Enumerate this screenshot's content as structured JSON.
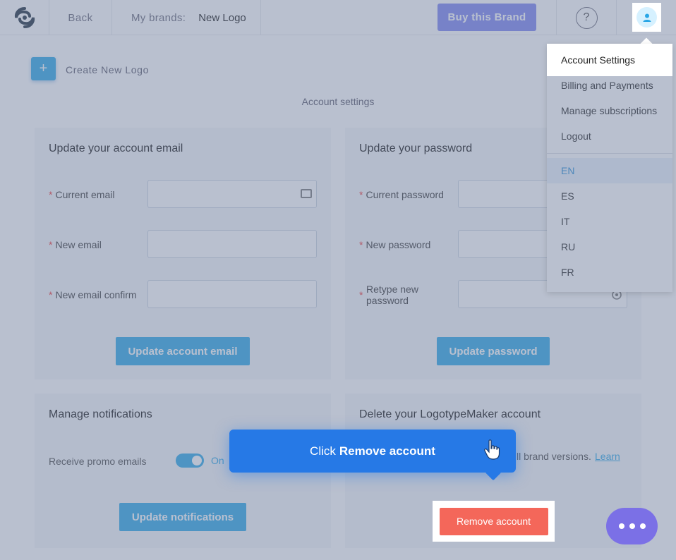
{
  "topbar": {
    "back_label": "Back",
    "brands_label": "My brands:",
    "brand_name": "New Logo",
    "buy_label": "Buy this Brand",
    "help_label": "?"
  },
  "main": {
    "create_label": "Create New Logo",
    "create_icon": "+",
    "section_title": "Account settings"
  },
  "email_card": {
    "title": "Update your account email",
    "fields": [
      "Current email",
      "New email",
      "New email confirm"
    ],
    "button": "Update account email"
  },
  "password_card": {
    "title": "Update your password",
    "fields": [
      "Current password",
      "New password",
      "Retype new password"
    ],
    "button": "Update password"
  },
  "notifications_card": {
    "title": "Manage notifications",
    "promo_label": "Receive promo emails",
    "toggle_state": "On",
    "button": "Update notifications"
  },
  "delete_card": {
    "title": "Delete your LogotypeMaker account",
    "text_visible": "ll brand versions.",
    "learn_link": "Learn",
    "button": "Remove account"
  },
  "tooltip": {
    "prefix": "Click",
    "strong": "Remove account"
  },
  "account_menu": {
    "items": [
      "Account Settings",
      "Billing and Payments",
      "Manage subscriptions",
      "Logout"
    ],
    "languages": [
      "EN",
      "ES",
      "IT",
      "RU",
      "FR"
    ],
    "active_language": "EN"
  },
  "colors": {
    "accent": "#28a6e6",
    "buy": "#7b83f0",
    "danger": "#f4675a",
    "tooltip": "#2679e6",
    "chat": "#7b70e6"
  }
}
